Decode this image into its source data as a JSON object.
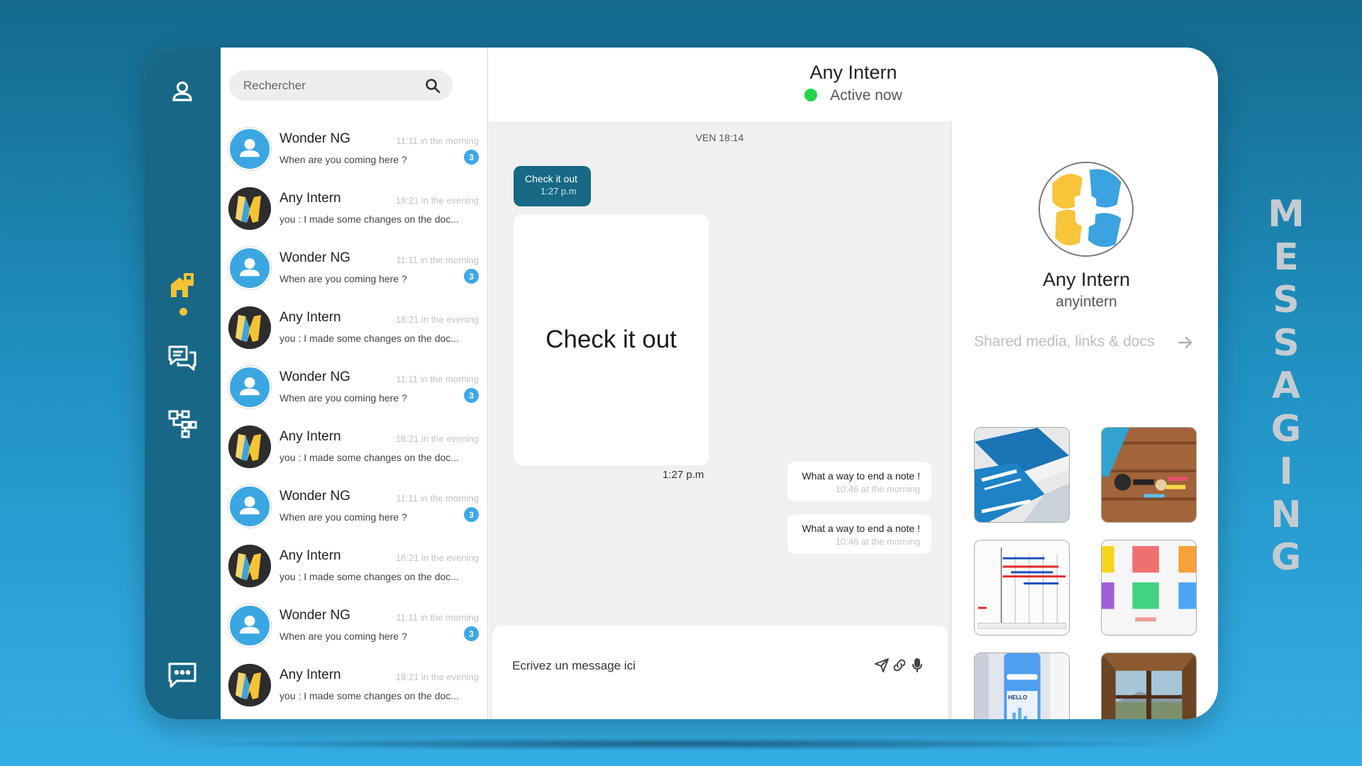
{
  "side_title": [
    "M",
    "E",
    "S",
    "S",
    "A",
    "G",
    "I",
    "N",
    "G"
  ],
  "nav": {
    "items": [
      "profile-icon",
      "home-icon",
      "chats-icon",
      "network-icon",
      "messages-icon"
    ],
    "active": "home-icon",
    "accent": "#f5c434"
  },
  "search": {
    "placeholder": "Rechercher"
  },
  "conversations": [
    {
      "name": "Wonder NG",
      "time": "11:11 in the morning",
      "preview": "When are you coming here ?",
      "badge": "3"
    },
    {
      "name": "Any Intern",
      "time": "18:21 in the evening",
      "preview": "you : I made some changes on the doc..."
    },
    {
      "name": "Wonder NG",
      "time": "11:11 in the morning",
      "preview": "When are you coming here ?",
      "badge": "3"
    },
    {
      "name": "Any Intern",
      "time": "18:21 in the evening",
      "preview": "you : I made some changes on the doc..."
    },
    {
      "name": "Wonder NG",
      "time": "11:11 in the morning",
      "preview": "When are you coming here ?",
      "badge": "3"
    },
    {
      "name": "Any Intern",
      "time": "18:21 in the evening",
      "preview": "you : I made some changes on the doc..."
    },
    {
      "name": "Wonder NG",
      "time": "11:11 in the morning",
      "preview": "When are you coming here ?",
      "badge": "3"
    },
    {
      "name": "Any Intern",
      "time": "18:21 in the evening",
      "preview": "you : I made some changes on the doc..."
    },
    {
      "name": "Wonder NG",
      "time": "11:11 in the morning",
      "preview": "When are you coming here ?",
      "badge": "3"
    },
    {
      "name": "Any Intern",
      "time": "18:21 in the evening",
      "preview": "you : I made some changes on the doc..."
    }
  ],
  "header": {
    "name": "Any Intern",
    "status": "Active now",
    "status_color": "#22d54a"
  },
  "chat": {
    "day_label": "VEN 18:14",
    "sent_text": "Check it out",
    "sent_time": "1:27 p.m",
    "card_text": "Check it out",
    "card_time": "1:27 p.m",
    "received": [
      {
        "text": "What a way to end a note !",
        "time": "10:46 at the morning"
      },
      {
        "text": "What a way to end a note !",
        "time": "10:46 at the morning"
      }
    ],
    "composer_placeholder": "Ecrivez un message ici"
  },
  "details": {
    "name": "Any Intern",
    "handle": "anyintern",
    "shared_label": "Shared media, links & docs",
    "media": [
      "book-cover-photo",
      "desk-flatlay-photo",
      "gantt-chart-image",
      "color-swatch-image",
      "mobile-app-mockup",
      "window-view-photo"
    ]
  },
  "colors": {
    "rail": "#186787",
    "bubble": "#176986",
    "badge": "#3ca8e6"
  }
}
